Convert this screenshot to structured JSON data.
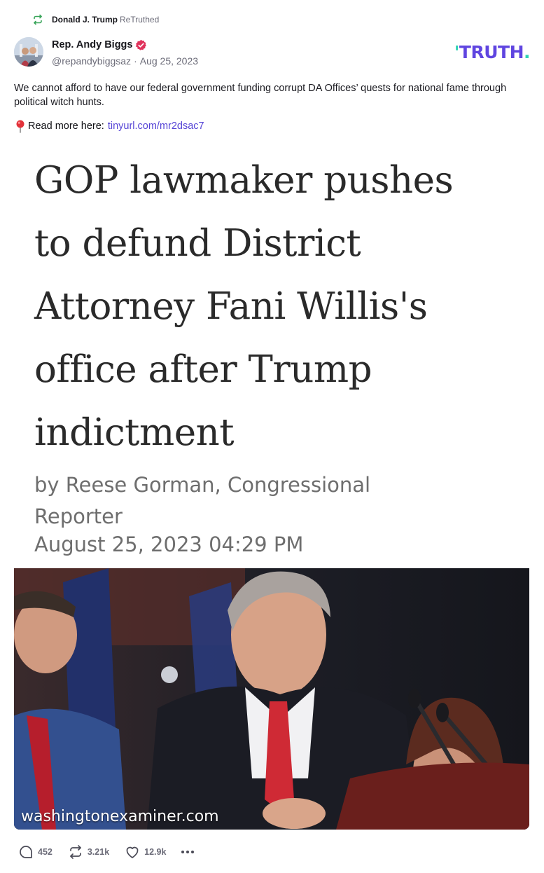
{
  "retruth": {
    "user": "Donald J. Trump",
    "label": "ReTruthed"
  },
  "author": {
    "name": "Rep. Andy Biggs",
    "handle": "@repandybiggsaz",
    "separator": "·",
    "date": "Aug 25, 2023"
  },
  "brand": {
    "logo_text": "TRUTH",
    "logo_dot": ".",
    "primary_color": "#5f45e0",
    "accent_color": "#2fd3b3"
  },
  "post": {
    "text": "We cannot afford to have our federal government funding corrupt DA Offices’ quests for national fame through political witch hunts.",
    "link_prefix": "Read more here:",
    "link_text": "tinyurl.com/mr2dsac7",
    "pin_icon": "pushpin-icon"
  },
  "media": {
    "headline_lines": [
      "GOP lawmaker pushes",
      "to defund District",
      "Attorney Fani Willis's",
      "office after Trump",
      "indictment"
    ],
    "byline_lines": [
      "by Reese Gorman, Congressional",
      "Reporter"
    ],
    "dateline": "August 25, 2023 04:29 PM",
    "watermark": "washingtonexaminer.com"
  },
  "actions": {
    "replies": "452",
    "retruths": "3.21k",
    "likes": "12.9k"
  }
}
